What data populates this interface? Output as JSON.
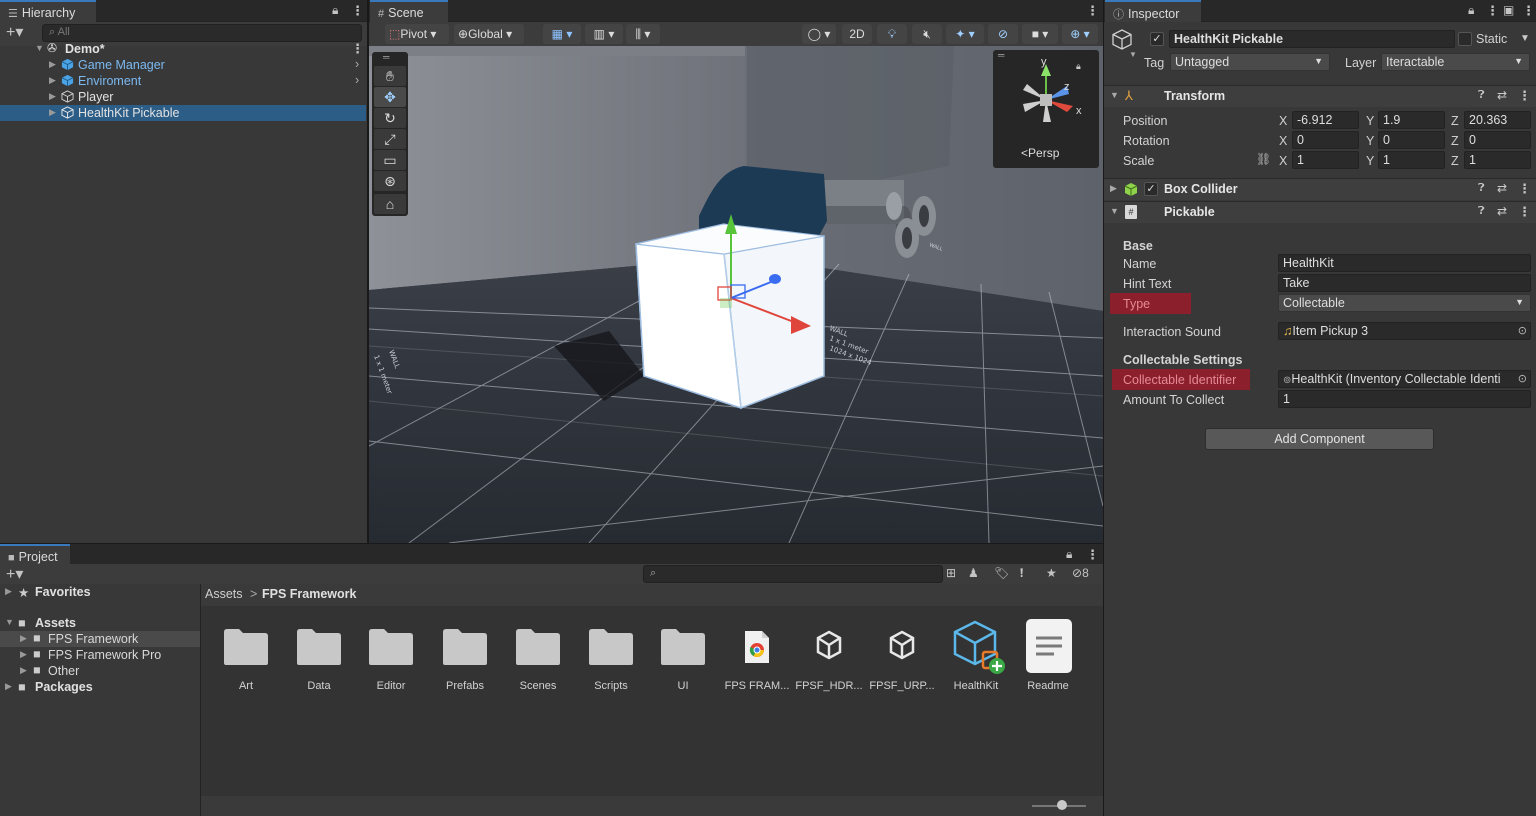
{
  "hierarchy": {
    "tab": "Hierarchy",
    "search_placeholder": "All",
    "scene_name": "Demo*",
    "items": [
      {
        "label": "Game Manager"
      },
      {
        "label": "Enviroment"
      },
      {
        "label": "Player"
      },
      {
        "label": "HealthKit Pickable"
      }
    ]
  },
  "scene": {
    "tab": "Scene",
    "pivot": "Pivot",
    "global": "Global",
    "mode_2d": "2D",
    "persp": "Persp",
    "gizmo_axes": {
      "y": "y",
      "z": "z",
      "x": "x"
    }
  },
  "inspector": {
    "tab": "Inspector",
    "object_name": "HealthKit Pickable",
    "static_label": "Static",
    "tag_label": "Tag",
    "tag_value": "Untagged",
    "layer_label": "Layer",
    "layer_value": "Iteractable",
    "transform": {
      "title": "Transform",
      "position_label": "Position",
      "rotation_label": "Rotation",
      "scale_label": "Scale",
      "position": {
        "x": "-6.912",
        "y": "1.9",
        "z": "20.363"
      },
      "rotation": {
        "x": "0",
        "y": "0",
        "z": "0"
      },
      "scale": {
        "x": "1",
        "y": "1",
        "z": "1"
      },
      "axis_x": "X",
      "axis_y": "Y",
      "axis_z": "Z"
    },
    "box_collider": {
      "title": "Box Collider"
    },
    "pickable": {
      "title": "Pickable",
      "base_header": "Base",
      "name_label": "Name",
      "name_value": "HealthKit",
      "hint_label": "Hint Text",
      "hint_value": "Take",
      "type_label": "Type",
      "type_value": "Collectable",
      "sound_label": "Interaction Sound",
      "sound_value": "Item Pickup 3",
      "collect_header": "Collectable Settings",
      "identifier_label": "Collectable Identifier",
      "identifier_value": "HealthKit (Inventory Collectable Identi",
      "amount_label": "Amount To Collect",
      "amount_value": "1"
    },
    "add_component": "Add Component",
    "highlight_color": "#8b1f2c"
  },
  "project": {
    "tab": "Project",
    "favorites": "Favorites",
    "assets": "Assets",
    "tree": [
      {
        "label": "FPS Framework"
      },
      {
        "label": "FPS Framework Pro"
      },
      {
        "label": "Other"
      }
    ],
    "packages": "Packages",
    "breadcrumb_root": "Assets",
    "breadcrumb_sep": ">",
    "breadcrumb_current": "FPS Framework",
    "hidden_count": "8",
    "assets_grid": [
      {
        "label": "Art",
        "icon": "folder-icon"
      },
      {
        "label": "Data",
        "icon": "folder-icon"
      },
      {
        "label": "Editor",
        "icon": "folder-icon"
      },
      {
        "label": "Prefabs",
        "icon": "folder-icon"
      },
      {
        "label": "Scenes",
        "icon": "folder-icon"
      },
      {
        "label": "Scripts",
        "icon": "folder-icon"
      },
      {
        "label": "UI",
        "icon": "folder-icon"
      },
      {
        "label": "FPS FRAM...",
        "icon": "chrome-doc-icon"
      },
      {
        "label": "FPSF_HDR...",
        "icon": "unity-package-icon"
      },
      {
        "label": "FPSF_URP...",
        "icon": "unity-package-icon"
      },
      {
        "label": "HealthKit",
        "icon": "prefab-icon"
      },
      {
        "label": "Readme",
        "icon": "document-icon"
      }
    ]
  }
}
